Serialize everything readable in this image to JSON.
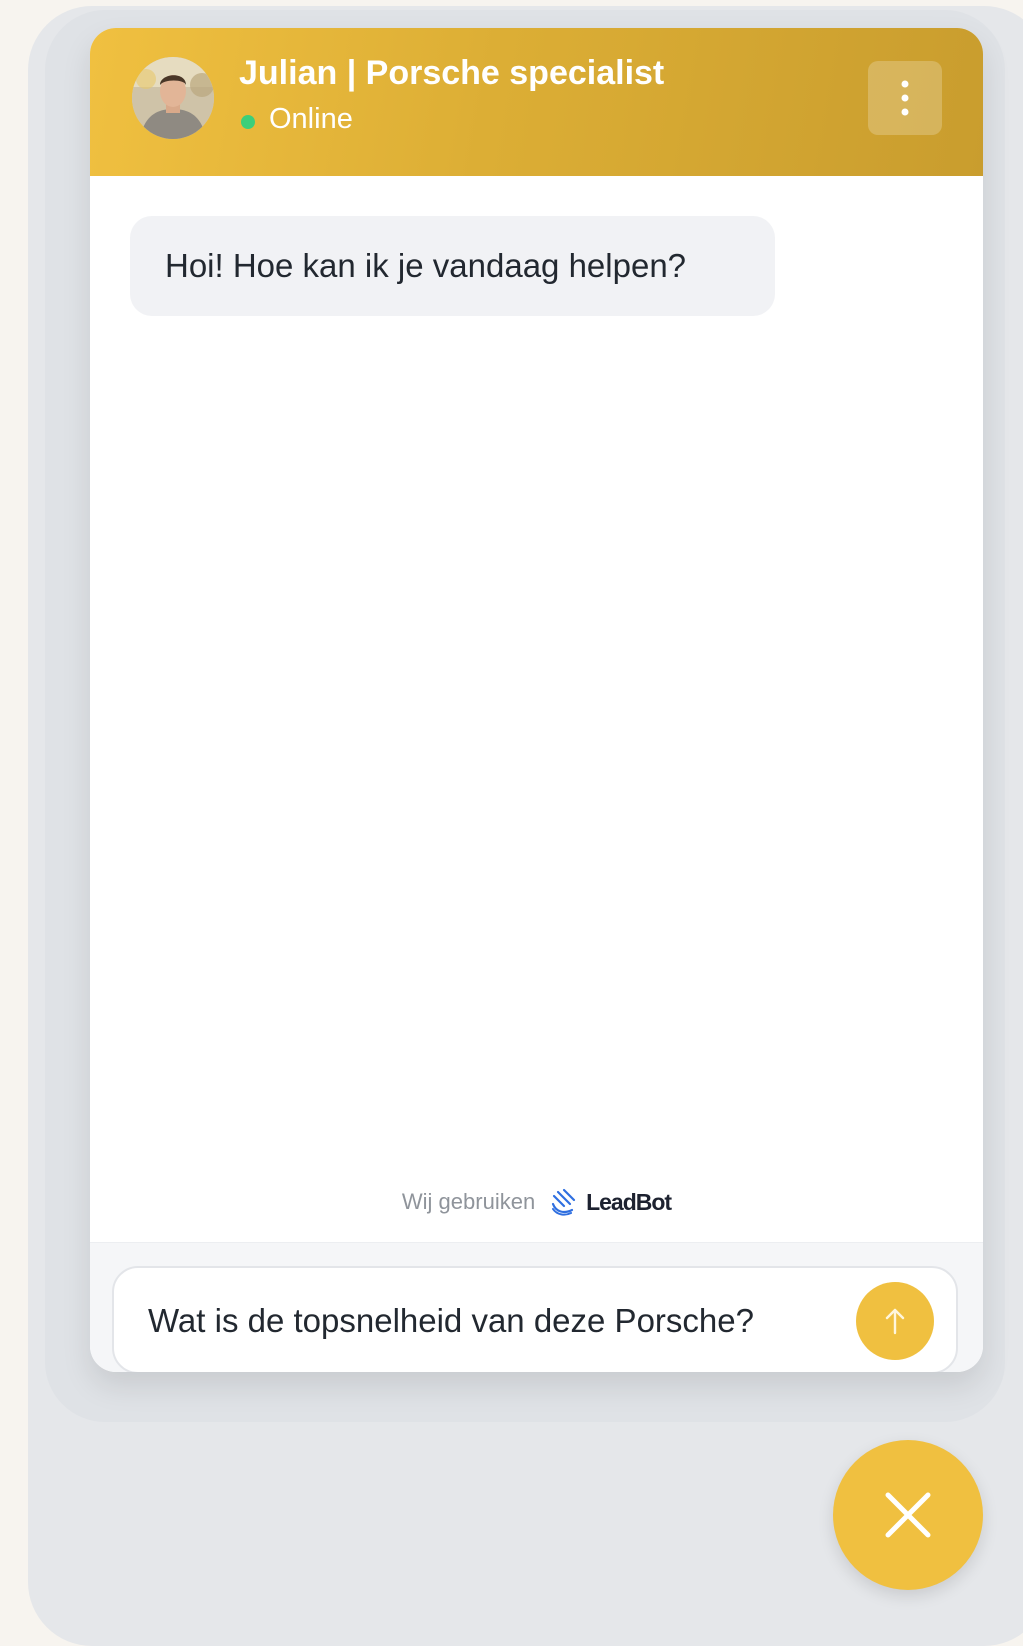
{
  "header": {
    "agent_name": "Julian | Porsche specialist",
    "status": "Online",
    "avatar_icon": "agent-avatar",
    "menu_icon": "vertical-dots-icon"
  },
  "messages": [
    {
      "sender": "agent",
      "text": "Hoi! Hoe kan ik je vandaag helpen?"
    }
  ],
  "powered_by": {
    "label": "Wij gebruiken",
    "brand": "LeadBot",
    "brand_icon": "leadbot-logo-icon"
  },
  "composer": {
    "value": "Wat is de topsnelheid van deze Porsche?",
    "send_icon": "arrow-up-icon"
  },
  "launcher": {
    "close_icon": "close-icon"
  },
  "colors": {
    "accent": "#f0c040",
    "accent_dark": "#c99d2e",
    "online": "#3ccf7a",
    "bubble": "#f1f2f5",
    "page_panel": "#e5e7ea"
  }
}
